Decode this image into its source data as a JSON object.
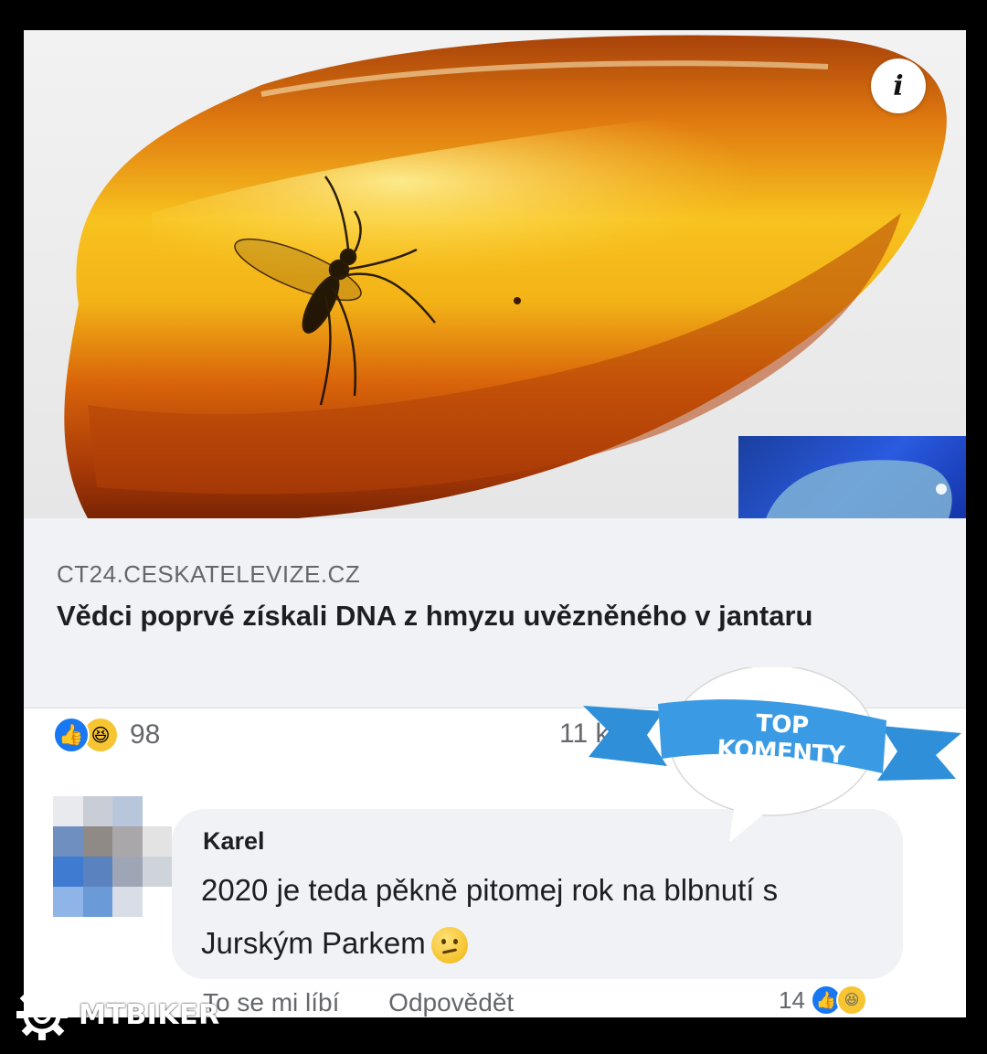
{
  "preview": {
    "domain": "CT24.CESKATELEVIZE.CZ",
    "headline": "Vědci poprvé získali DNA z hmyzu uvězněného v jantaru"
  },
  "info_icon": "i",
  "reactions": {
    "icons": [
      "like-icon",
      "haha-icon"
    ],
    "count": "98",
    "comments_count": "11 kom"
  },
  "comment": {
    "author": "Karel",
    "text": "2020 je teda pěkně pitomej rok na blbnutí s Jurským Parkem",
    "emoji": "confused-face-icon",
    "action_like": "To se mi líbí",
    "action_reply": "Odpovědět",
    "likes": "14"
  },
  "badge": {
    "label": "TOP KOMENTY"
  },
  "watermark": {
    "text": "MTBIKER"
  },
  "colors": {
    "facebook_blue": "#1877f2",
    "ribbon_blue": "#2f8fd8",
    "bubble_gray": "#f0f2f5",
    "amber": "#e07a10"
  }
}
